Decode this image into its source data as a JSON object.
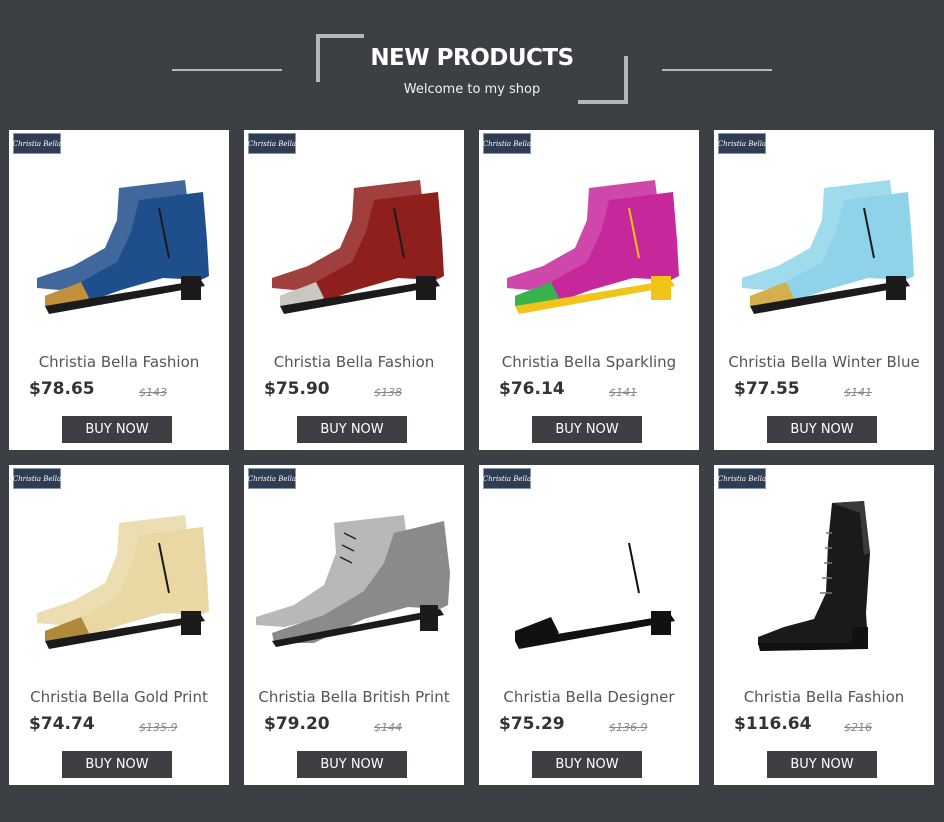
{
  "header": {
    "title": "NEW PRODUCTS",
    "subtitle": "Welcome to my shop"
  },
  "brand_logo_text": "Christia Bella",
  "products": [
    {
      "name": "Christia Bella Fashion",
      "price": "$78.65",
      "old_price": "$143",
      "button": "BUY NOW",
      "shoe_colors": [
        "#1f4e8c",
        "#c0913a",
        "#1b1b1b"
      ]
    },
    {
      "name": "Christia Bella Fashion",
      "price": "$75.90",
      "old_price": "$138",
      "button": "BUY NOW",
      "shoe_colors": [
        "#8e1f1c",
        "#c9c7c3",
        "#1b1b1b"
      ]
    },
    {
      "name": "Christia Bella Sparkling",
      "price": "$76.14",
      "old_price": "$141",
      "button": "BUY NOW",
      "shoe_colors": [
        "#c6289c",
        "#37b24d",
        "#f0c419"
      ]
    },
    {
      "name": "Christia Bella Winter Blue",
      "price": "$77.55",
      "old_price": "$141",
      "button": "BUY NOW",
      "shoe_colors": [
        "#8fd3ea",
        "#d4b04c",
        "#1b1b1b"
      ]
    },
    {
      "name": "Christia Bella Gold Print",
      "price": "$74.74",
      "old_price": "$135.9",
      "button": "BUY NOW",
      "shoe_colors": [
        "#e9d8a4",
        "#b08a3a",
        "#1b1b1b"
      ]
    },
    {
      "name": "Christia Bella British Print",
      "price": "$79.20",
      "old_price": "$144",
      "button": "BUY NOW",
      "shoe_colors": [
        "#b8b8b8",
        "#8a8a8a",
        "#1b1b1b"
      ]
    },
    {
      "name": "Christia Bella Designer",
      "price": "$75.29",
      "old_price": "$136.9",
      "button": "BUY NOW",
      "shoe_colors": [
        "#ffffff",
        "#111111",
        "#111111"
      ]
    },
    {
      "name": "Christia Bella Fashion",
      "price": "$116.64",
      "old_price": "$216",
      "button": "BUY NOW",
      "shoe_colors": [
        "#1a1a1a",
        "#3a3a3a",
        "#111111"
      ]
    }
  ]
}
